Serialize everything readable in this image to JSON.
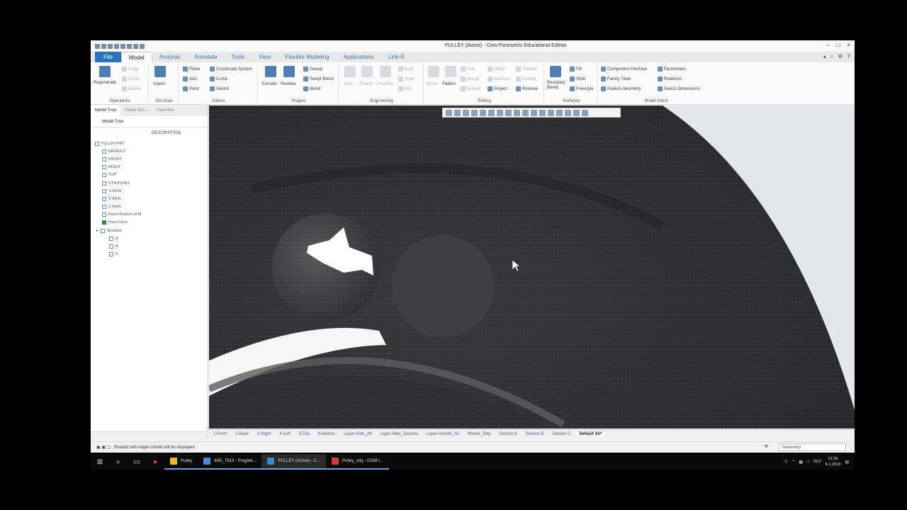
{
  "window": {
    "title": "PULLEY (Active) - Creo Parametric Educational Edition",
    "controls": [
      "–",
      "□",
      "×"
    ]
  },
  "tabs": [
    "File",
    "Model",
    "Analysis",
    "Annotate",
    "Tools",
    "View",
    "Flexible Modeling",
    "Applications",
    "Link-R"
  ],
  "active_tab": "Model",
  "ribbon": {
    "operations": {
      "regenerate": "Regenerate",
      "copy": "Copy",
      "paste": "Paste",
      "delete": "Delete",
      "label": "Operations"
    },
    "get_data": {
      "import": "Import",
      "label": "Get Data"
    },
    "datum": {
      "plane": "Plane",
      "axis": "Axis",
      "point": "Point",
      "csys": "Coordinate System",
      "curve": "Curve",
      "sketch": "Sketch",
      "label": "Datum"
    },
    "shapes": {
      "extrude": "Extrude",
      "revolve": "Revolve",
      "sweep": "Sweep",
      "swept_blend": "Swept Blend",
      "blend": "Blend",
      "label": "Shapes"
    },
    "engineering": {
      "hole": "Hole",
      "round": "Round",
      "chamfer": "Chamfer",
      "draft": "Draft",
      "shell": "Shell",
      "rib": "Rib",
      "label": "Engineering"
    },
    "editing": {
      "mirror": "Mirror",
      "pattern": "Pattern",
      "trim": "Trim",
      "merge": "Merge",
      "extend": "Extend",
      "offset": "Offset",
      "intersect": "Intersect",
      "project": "Project",
      "thicken": "Thicken",
      "solidify": "Solidify",
      "remove": "Remove",
      "label": "Editing"
    },
    "surfaces": {
      "boundary_blend": "Boundary Blend",
      "fill": "Fill",
      "style": "Style",
      "freestyle": "Freestyle",
      "label": "Surfaces"
    },
    "model_intent": {
      "component_interface": "Component Interface",
      "family_table": "Family Table",
      "publish_geometry": "Publish Geometry",
      "parameters": "Parameters",
      "relations": "Relations",
      "switch_dimensions": "Switch Dimensions",
      "label": "Model Intent"
    }
  },
  "left_panel": {
    "tabs": [
      "Model Tree",
      "Folder Bro...",
      "Favorites"
    ],
    "header": "Model Tree",
    "column": "DESCRIPTION",
    "tree": [
      "PULLEY.PRT",
      "DEFAULT",
      "FRONT",
      "RIGHT",
      "TOP",
      "CTR-POINT",
      "X-AXIS",
      "Y-AXIS",
      "Z-AXIS",
      "Facet Feature id M",
      "Insert Here",
      "Sections",
      "A",
      "B",
      "C"
    ]
  },
  "view_tabs": [
    "1-Front",
    "2-Back",
    "3-Right",
    "4-Left",
    "5-Top",
    "6-Bottom",
    "Layer-Hide_All",
    "Layer-Hide_Datums",
    "Layer-Unhide_All",
    "Master_Rep",
    "Section A",
    "Section B",
    "Section C",
    "Default All*"
  ],
  "active_view": "Default All*",
  "status": {
    "message": "Shaded with edges model will be displayed",
    "filter": "Geometry"
  },
  "taskbar": {
    "apps": [
      {
        "label": "Pulley",
        "color": "#e8b82f"
      },
      {
        "label": "IMG_7913 - Pregled...",
        "color": "#4a8ad8"
      },
      {
        "label": "PULLEY (Active) - C...",
        "color": "#3a8ad0"
      },
      {
        "label": "Pulley_orig - GOM I...",
        "color": "#d43a3a"
      }
    ],
    "time": "21:06",
    "date": "6.1.2018",
    "lang": "SLV"
  },
  "colors": {
    "accent": "#2a71c2",
    "tab_text": "#3a76b8",
    "scan_dark": "#3e3e40"
  }
}
